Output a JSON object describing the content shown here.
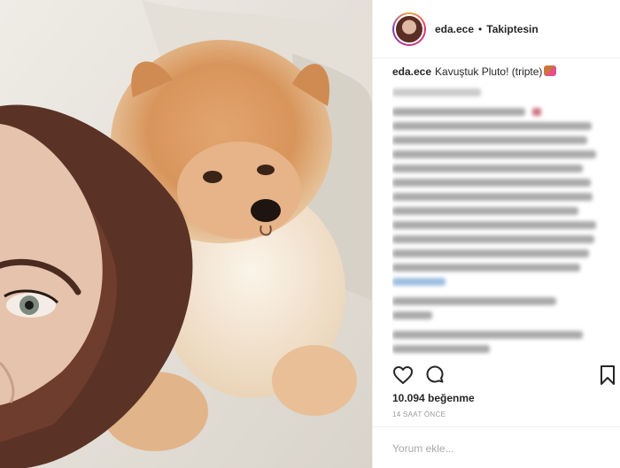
{
  "post": {
    "username": "eda.ece",
    "separator": "•",
    "follow_status": "Takiptesin",
    "caption_username": "eda.ece",
    "caption_text": "Kavuştuk Pluto! (tripte)",
    "likes": "10.094 beğenme",
    "time_ago": "14 SAAT ÖNCE",
    "comment_placeholder": "Yorum ekle..."
  },
  "icons": {
    "like": "heart-icon",
    "comment": "comment-icon",
    "save": "bookmark-icon"
  },
  "colors": {
    "text": "#262626",
    "muted": "#999999",
    "border": "#efefef",
    "placeholder": "#a8a8a8"
  }
}
